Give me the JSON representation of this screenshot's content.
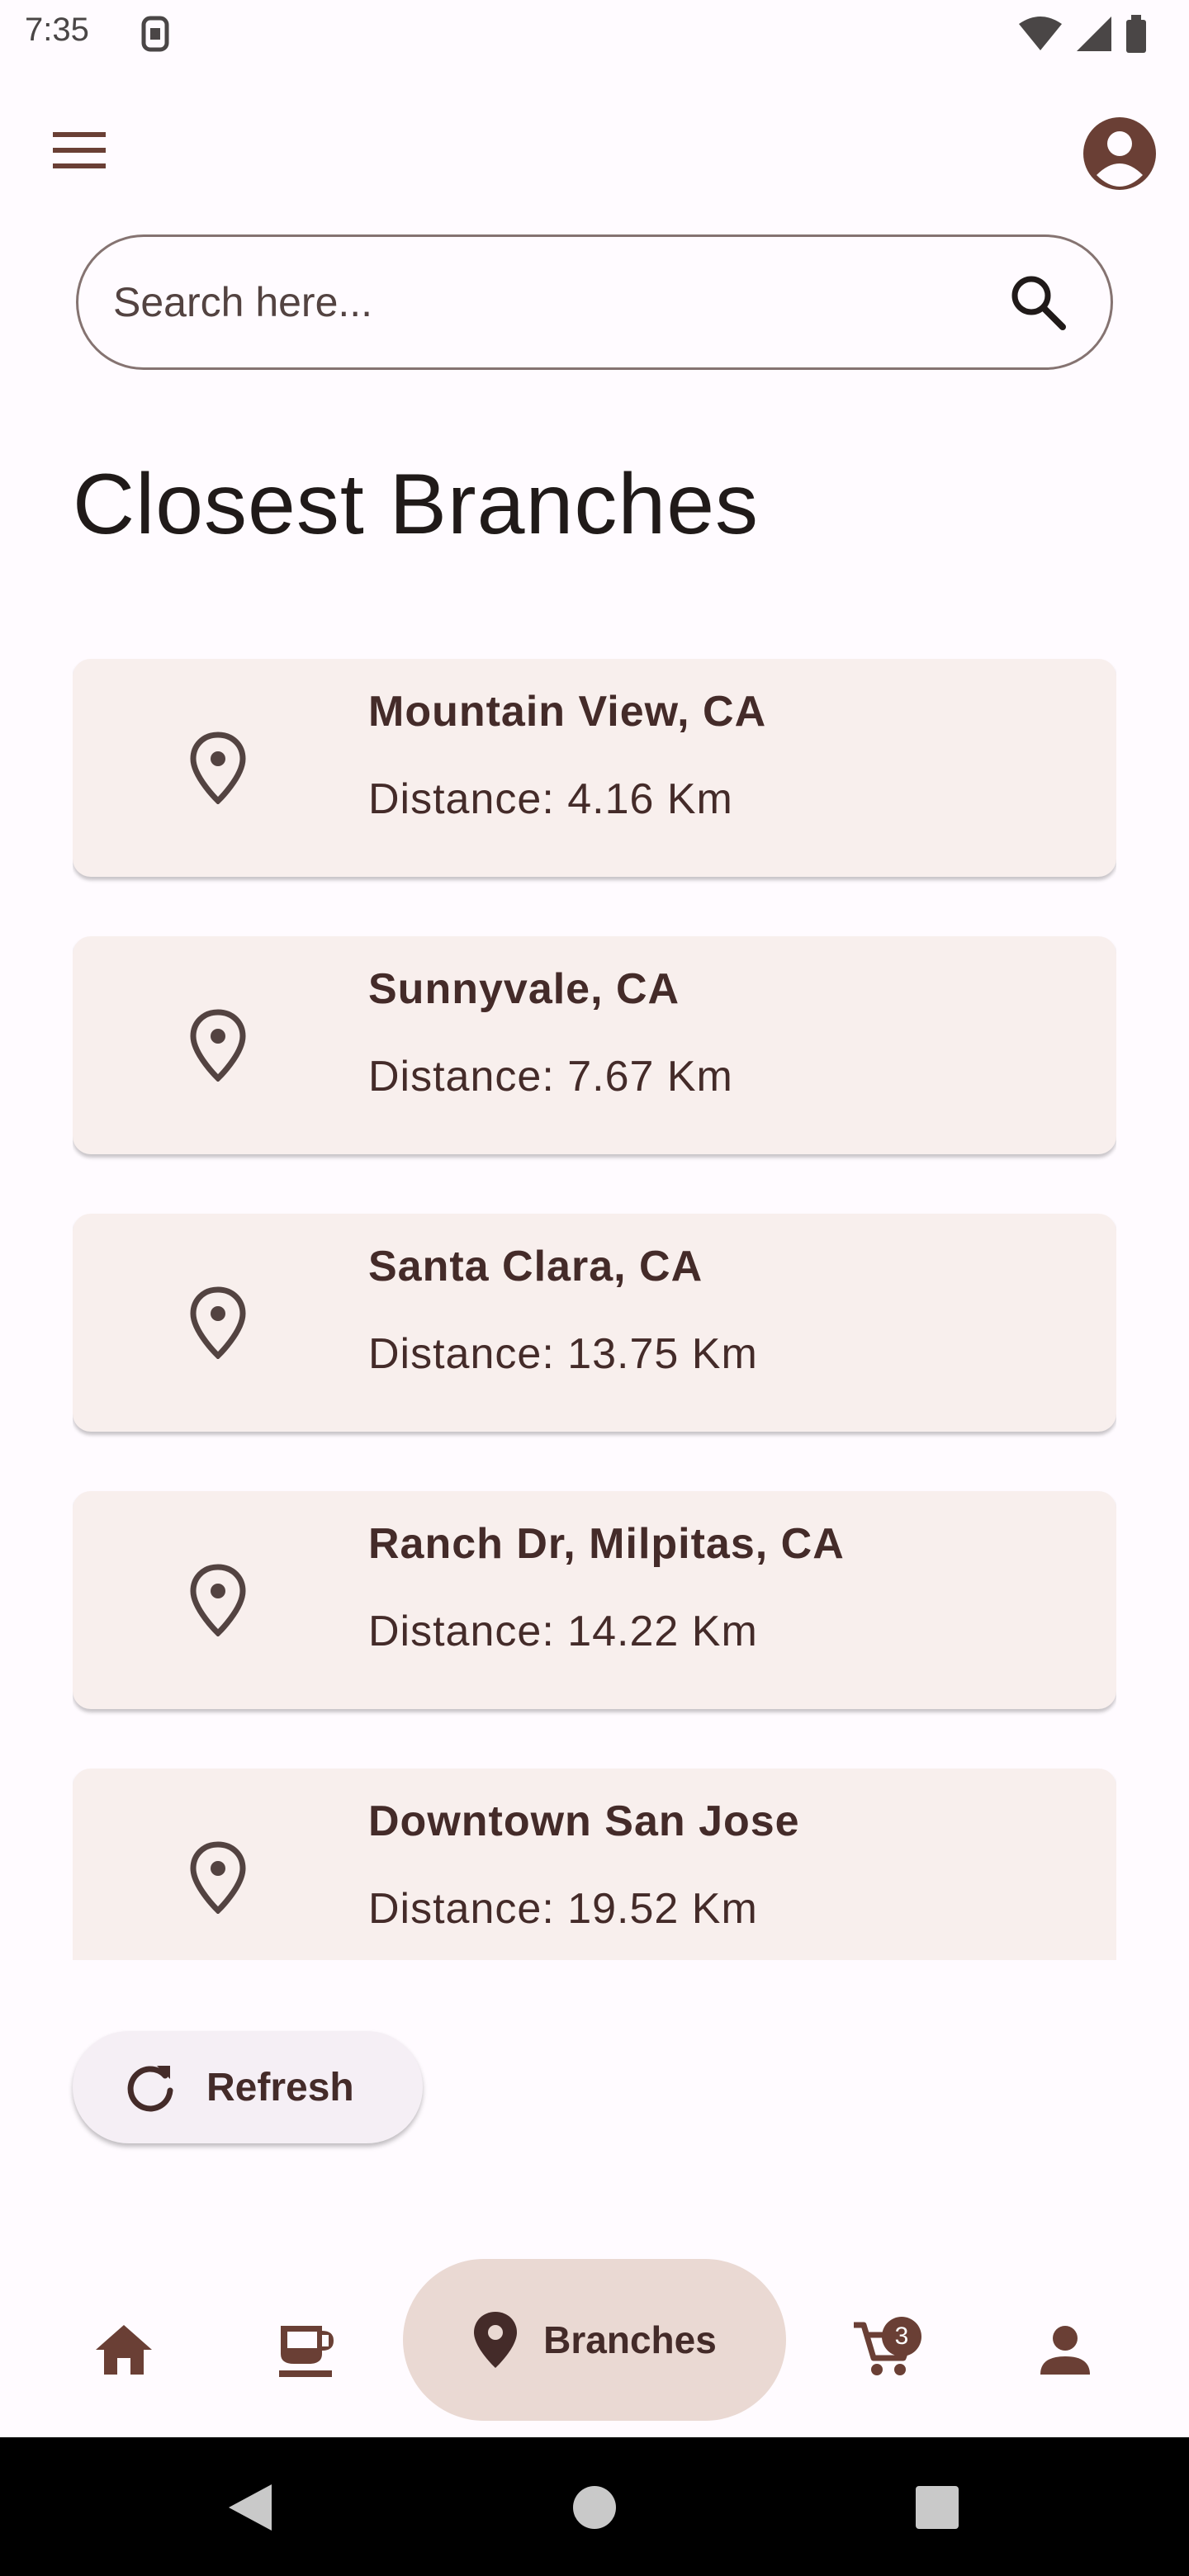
{
  "status_bar": {
    "time": "7:35",
    "icons": [
      "sim-icon",
      "wifi-icon",
      "signal-icon",
      "battery-icon"
    ]
  },
  "app_bar": {
    "menu_icon": "menu-icon",
    "profile_icon": "account-circle-icon"
  },
  "search": {
    "placeholder": "Search here...",
    "value": ""
  },
  "page": {
    "title": "Closest Branches"
  },
  "branches": [
    {
      "name": "Mountain View, CA",
      "distance": "Distance: 4.16 Km"
    },
    {
      "name": "Sunnyvale, CA",
      "distance": "Distance: 7.67 Km"
    },
    {
      "name": "Santa Clara, CA",
      "distance": "Distance: 13.75 Km"
    },
    {
      "name": "Ranch Dr, Milpitas, CA",
      "distance": "Distance: 14.22 Km"
    },
    {
      "name": "Downtown San Jose",
      "distance": "Distance: 19.52 Km"
    }
  ],
  "refresh": {
    "label": "Refresh"
  },
  "bottom_nav": {
    "items": [
      {
        "icon": "home-icon"
      },
      {
        "icon": "coffee-icon"
      },
      {
        "icon": "location-pin-icon",
        "label": "Branches",
        "active": true
      },
      {
        "icon": "cart-icon",
        "badge": "3"
      },
      {
        "icon": "person-icon"
      }
    ]
  },
  "colors": {
    "accent": "#6a3f35",
    "card_bg": "#f8efed",
    "active_nav_bg": "#ead9d3",
    "text_primary": "#442b29"
  }
}
